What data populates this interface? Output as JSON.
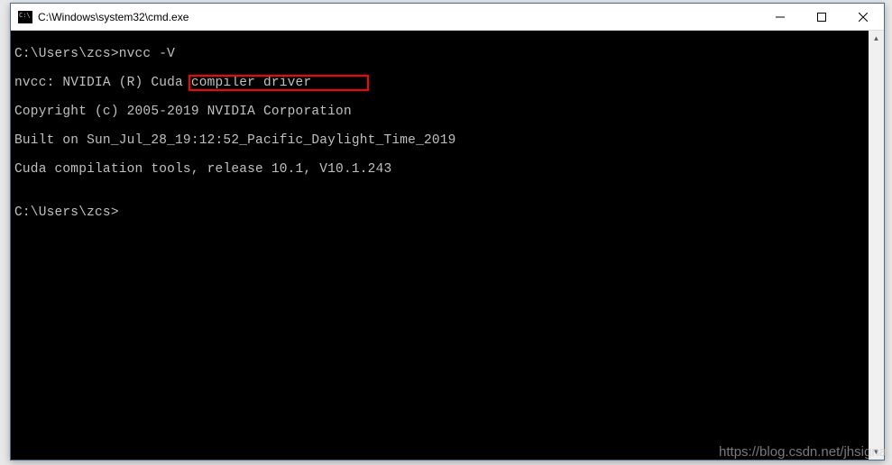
{
  "titlebar": {
    "title": "C:\\Windows\\system32\\cmd.exe"
  },
  "terminal": {
    "prompt1": "C:\\Users\\zcs>",
    "command1": "nvcc -V",
    "output": {
      "line1": "nvcc: NVIDIA (R) Cuda compiler driver",
      "line2": "Copyright (c) 2005-2019 NVIDIA Corporation",
      "line3": "Built on Sun_Jul_28_19:12:52_Pacific_Daylight_Time_2019",
      "line4_prefix": "Cuda compilation tools,",
      "line4_highlight": " release 10.1, V10.1.243"
    },
    "prompt2": "C:\\Users\\zcs>"
  },
  "watermark": "https://blog.csdn.net/jhsigna",
  "scrollbar": {
    "up": "▲",
    "down": "▼"
  }
}
